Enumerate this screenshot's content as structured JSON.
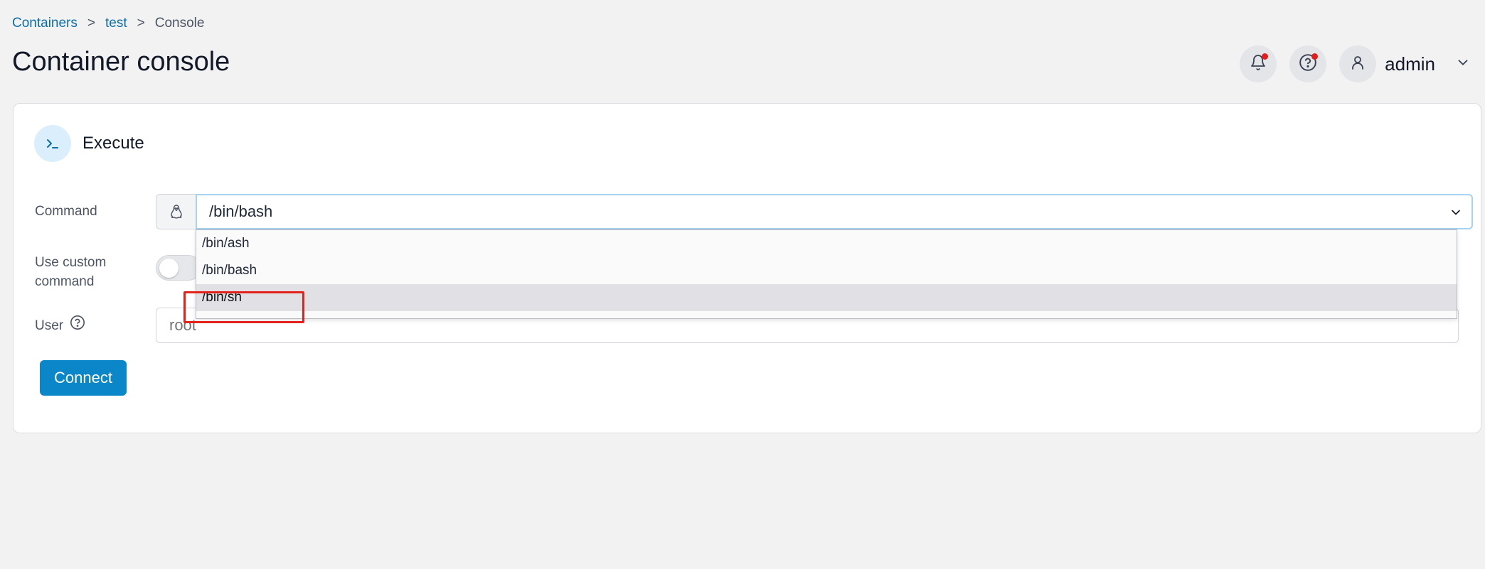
{
  "breadcrumb": {
    "items": [
      "Containers",
      "test"
    ],
    "separator": ">",
    "current": "Console"
  },
  "page": {
    "title": "Container console"
  },
  "header": {
    "user": "admin"
  },
  "card": {
    "title": "Execute",
    "command_label": "Command",
    "custom_label": "Use custom command",
    "user_label": "User",
    "command_value": "/bin/bash",
    "custom_enabled": false,
    "user_placeholder": "root",
    "connect_label": "Connect"
  },
  "dropdown": {
    "options": [
      "/bin/ash",
      "/bin/bash",
      "/bin/sh"
    ],
    "selected": "/bin/sh"
  },
  "colors": {
    "accent": "#0b86c9",
    "link": "#0b6ea8",
    "highlight": "#e3231b",
    "notification_dot": "#e11d1d"
  }
}
